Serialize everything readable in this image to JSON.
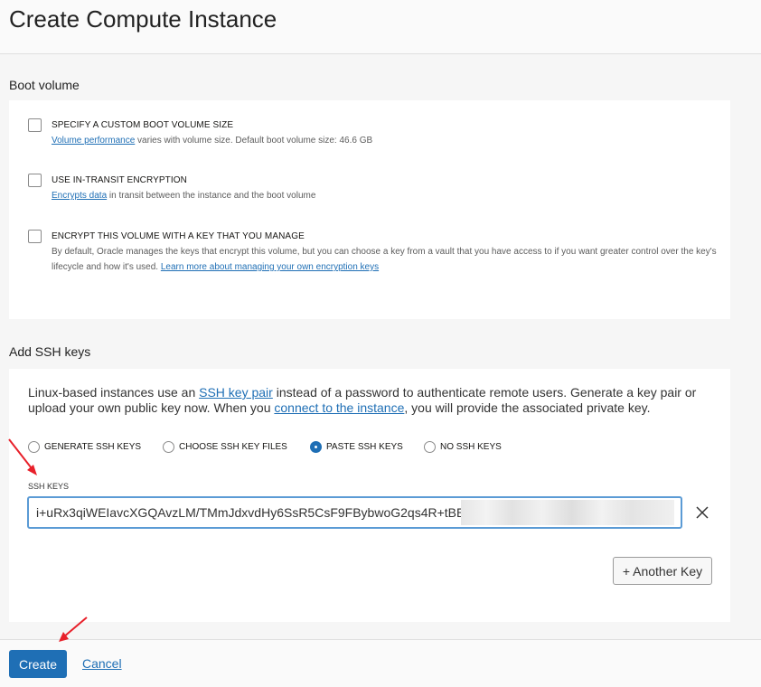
{
  "header": {
    "title": "Create Compute Instance"
  },
  "boot_volume": {
    "title": "Boot volume",
    "options": [
      {
        "label": "SPECIFY A CUSTOM BOOT VOLUME SIZE",
        "link": "Volume performance",
        "desc": " varies with volume size. Default boot volume size: 46.6 GB"
      },
      {
        "label": "USE IN-TRANSIT ENCRYPTION",
        "link": "Encrypts data",
        "desc": " in transit between the instance and the boot volume"
      },
      {
        "label": "ENCRYPT THIS VOLUME WITH A KEY THAT YOU MANAGE",
        "desc": "By default, Oracle manages the keys that encrypt this volume, but you can choose a key from a vault that you have access to if you want greater control over the key's lifecycle and how it's used. ",
        "link": "Learn more about managing your own encryption keys"
      }
    ]
  },
  "ssh": {
    "title": "Add SSH keys",
    "intro_1": "Linux-based instances use an ",
    "intro_link_1": "SSH key pair",
    "intro_2": " instead of a password to authenticate remote users. Generate a key pair or upload your own public key now. When you ",
    "intro_link_2": "connect to the instance",
    "intro_3": ", you will provide the associated private key.",
    "radios": [
      "GENERATE SSH KEYS",
      "CHOOSE SSH KEY FILES",
      "PASTE SSH KEYS",
      "NO SSH KEYS"
    ],
    "selected": "PASTE SSH KEYS",
    "keys_label": "SSH KEYS",
    "key_value": "i+uRx3qiWEIavcXGQAvzLM/TMmJdxvdHy6SsR5CsF9FBybwoG2qs4R+tBE",
    "another_key": "+ Another Key"
  },
  "footer": {
    "create": "Create",
    "cancel": "Cancel"
  },
  "colors": {
    "accent": "#1f6fb5",
    "arrow": "#e8202a"
  },
  "icons": {
    "clear": "close-icon",
    "annotation": "red-arrow-icon"
  }
}
